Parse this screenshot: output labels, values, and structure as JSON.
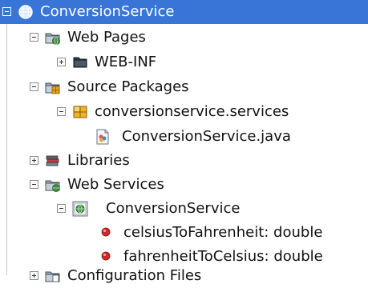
{
  "tree": {
    "items": [
      {
        "label": "ConversionService",
        "icon": "web-project-icon",
        "expanded": true,
        "selected": true
      },
      {
        "label": "Web Pages",
        "icon": "web-pages-folder-icon",
        "expanded": true
      },
      {
        "label": "WEB-INF",
        "icon": "folder-icon",
        "expanded": false
      },
      {
        "label": "Source Packages",
        "icon": "source-packages-icon",
        "expanded": true
      },
      {
        "label": "conversionservice.services",
        "icon": "package-icon",
        "expanded": true
      },
      {
        "label": "ConversionService.java",
        "icon": "java-file-icon"
      },
      {
        "label": "Libraries",
        "icon": "libraries-icon",
        "expanded": false
      },
      {
        "label": "Web Services",
        "icon": "web-services-icon",
        "expanded": true
      },
      {
        "label": "ConversionService",
        "icon": "web-service-icon",
        "expanded": true
      },
      {
        "label": "celsiusToFahrenheit: double",
        "icon": "operation-icon"
      },
      {
        "label": "fahrenheitToCelsius: double",
        "icon": "operation-icon"
      },
      {
        "label": "Configuration Files",
        "icon": "config-files-icon",
        "expanded": false
      }
    ]
  },
  "colors": {
    "selection": "#3875d7",
    "operation": "#cc2020"
  }
}
